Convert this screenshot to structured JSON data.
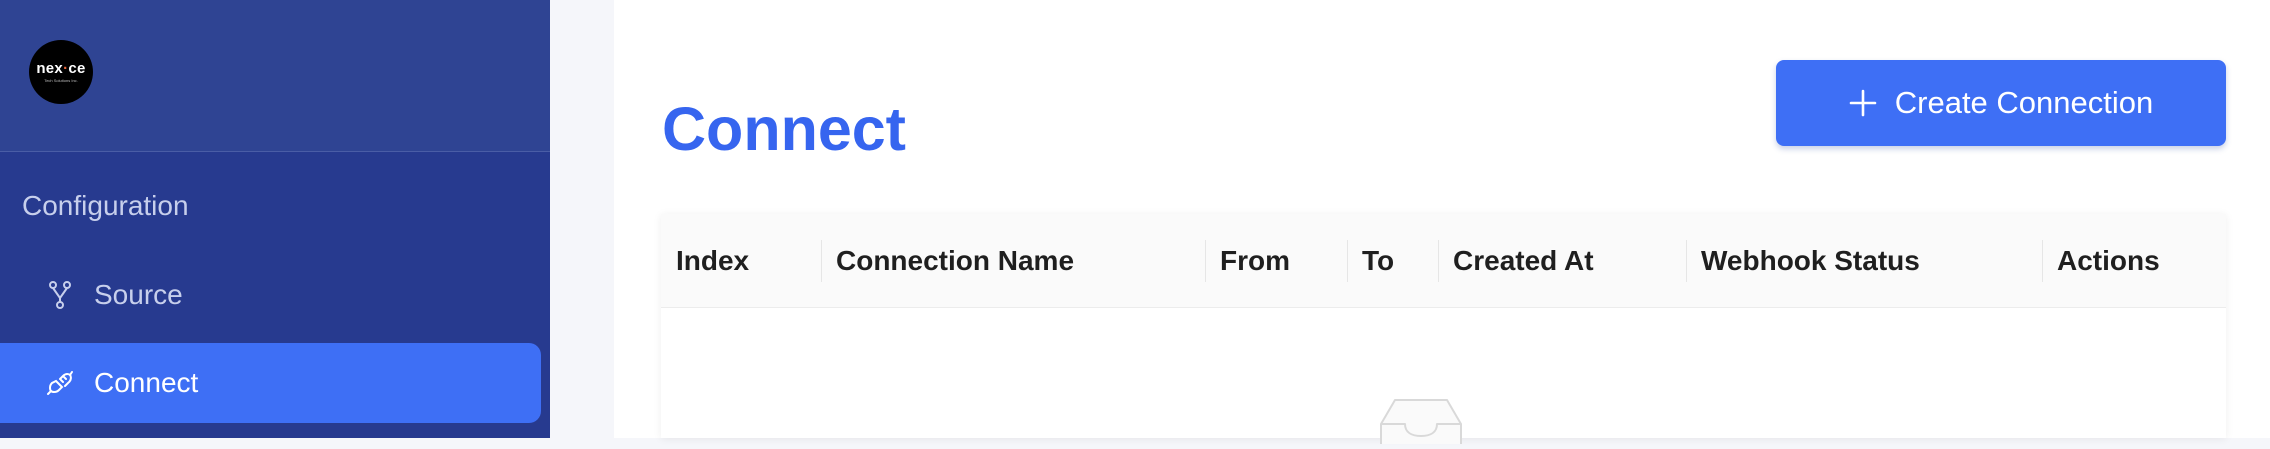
{
  "brand": {
    "logo_text_1": "nex",
    "logo_text_dot": "·",
    "logo_text_2": "ce",
    "logo_subtext": "Tech Solutions Inc."
  },
  "sidebar": {
    "section_title": "Configuration",
    "items": [
      {
        "label": "Source",
        "icon": "fork-icon",
        "active": false
      },
      {
        "label": "Connect",
        "icon": "plug-icon",
        "active": true
      }
    ]
  },
  "page": {
    "title": "Connect",
    "create_button_label": "Create Connection"
  },
  "table": {
    "columns": [
      "Index",
      "Connection Name",
      "From",
      "To",
      "Created At",
      "Webhook Status",
      "Actions"
    ],
    "rows": []
  },
  "colors": {
    "sidebar_bg": "#273a8f",
    "accent": "#3e6ff5",
    "title": "#3665ef"
  }
}
